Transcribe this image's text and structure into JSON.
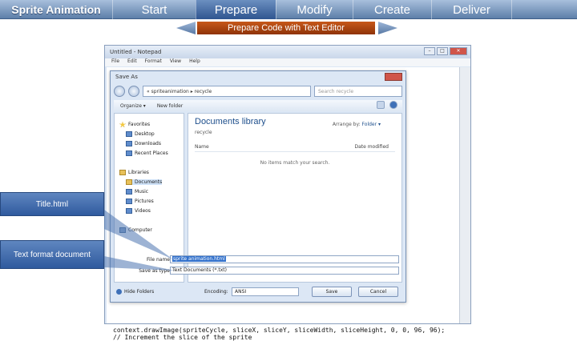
{
  "nav": {
    "title": "Sprite Animation",
    "steps": [
      "Start",
      "Prepare",
      "Modify",
      "Create",
      "Deliver"
    ],
    "active_step": "Prepare"
  },
  "subnav": {
    "title": "Prepare Code with Text Editor"
  },
  "notepad": {
    "title": "Untitled - Notepad",
    "menu": [
      "File",
      "Edit",
      "Format",
      "View",
      "Help"
    ],
    "code_lines": [
      "context.drawImage(spriteCycle, sliceX, sliceY, sliceWidth, sliceHeight, 0, 0, 96, 96);",
      "// Increment the slice of the sprite"
    ]
  },
  "save_dialog": {
    "title": "Save As",
    "address": "« spriteanimation ▸ recycle",
    "search_placeholder": "Search recycle",
    "toolbar": {
      "organize": "Organize ▾",
      "new_folder": "New folder"
    },
    "nav_items": [
      {
        "label": "Favorites",
        "icon": "star-icon"
      },
      {
        "label": "Desktop",
        "icon": "folder-icon"
      },
      {
        "label": "Downloads",
        "icon": "folder-icon"
      },
      {
        "label": "Recent Places",
        "icon": "folder-icon"
      },
      {
        "label": "Libraries",
        "icon": "library-icon"
      },
      {
        "label": "Documents",
        "icon": "folder-icon"
      },
      {
        "label": "Music",
        "icon": "folder-icon"
      },
      {
        "label": "Pictures",
        "icon": "folder-icon"
      },
      {
        "label": "Videos",
        "icon": "folder-icon"
      },
      {
        "label": "Computer",
        "icon": "computer-icon"
      }
    ],
    "library_title": "Documents library",
    "library_sub": "recycle",
    "arrange_label": "Arrange by:",
    "arrange_value": "Folder ▾",
    "col_name": "Name",
    "col_date": "Date modified",
    "empty_message": "No items match your search.",
    "file_name_label": "File name:",
    "file_name_value": "sprite animation.html",
    "save_type_label": "Save as type:",
    "save_type_value": "Text Documents (*.txt)",
    "hide_folders": "Hide Folders",
    "encoding_label": "Encoding:",
    "encoding_value": "ANSI",
    "save_button": "Save",
    "cancel_button": "Cancel"
  },
  "callouts": {
    "title_html": "Title.html",
    "text_format": "Text format document"
  }
}
